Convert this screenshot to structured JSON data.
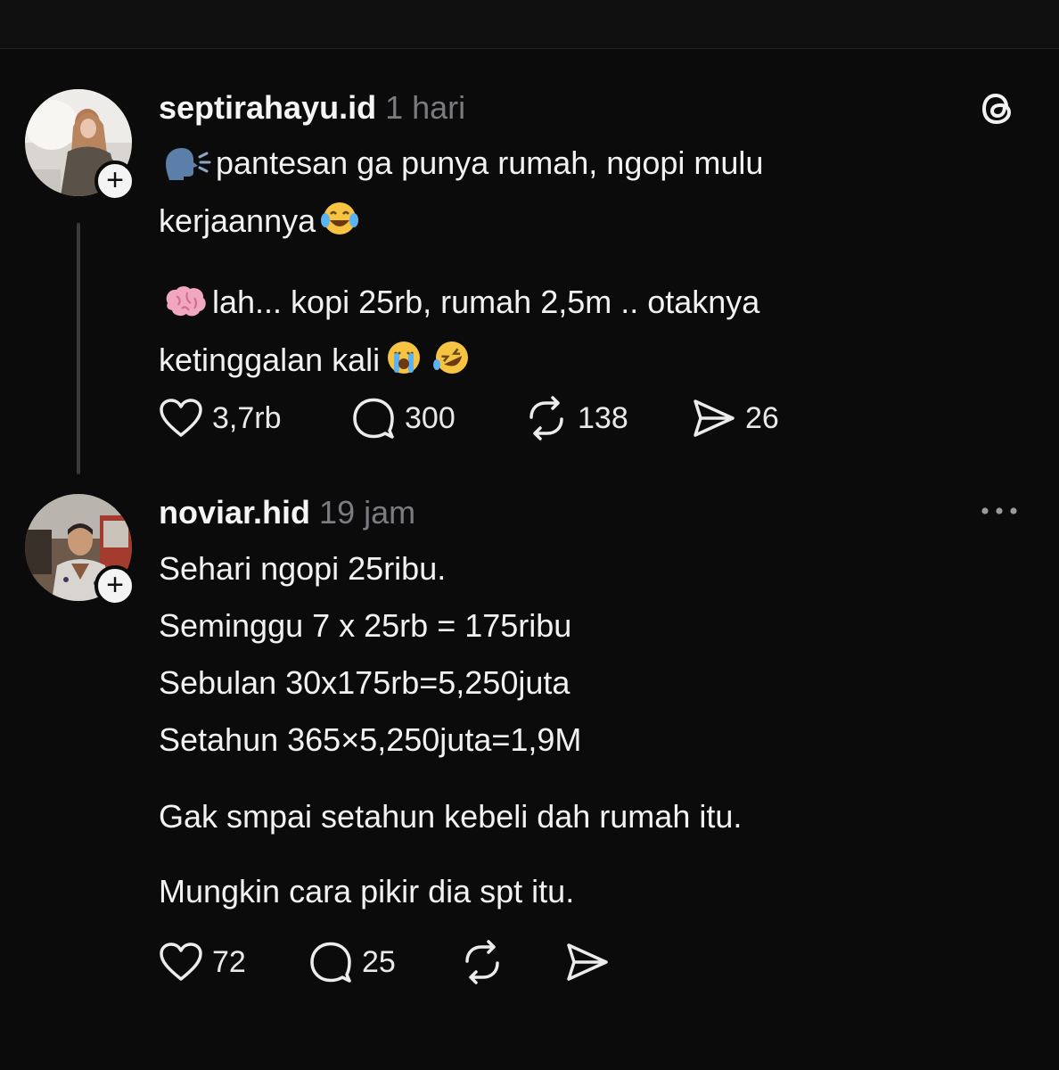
{
  "post1": {
    "username": "septirahayu.id",
    "time": "1 hari",
    "line1": "pantesan ga punya rumah, ngopi mulu",
    "line2": "kerjaannya",
    "line3": "lah... kopi 25rb, rumah 2,5m .. otaknya",
    "line4": "ketinggalan kali",
    "likes": "3,7rb",
    "replies": "300",
    "reposts": "138",
    "shares": "26",
    "follow_label": "+"
  },
  "post2": {
    "username": "noviar.hid",
    "time": "19 jam",
    "lines": [
      "Sehari ngopi 25ribu.",
      "Seminggu 7 x 25rb =  175ribu",
      "Sebulan 30x175rb=5,250juta",
      "Setahun 365×5,250juta=1,9M"
    ],
    "para2": "Gak smpai setahun kebeli dah rumah itu.",
    "para3": "Mungkin cara pikir dia spt itu.",
    "likes": "72",
    "replies": "25",
    "follow_label": "+"
  },
  "icons": {
    "app": "threads-logo-icon",
    "more": "more-options-icon",
    "like": "heart-icon",
    "reply": "comment-icon",
    "repost": "repost-icon",
    "share": "send-icon"
  }
}
